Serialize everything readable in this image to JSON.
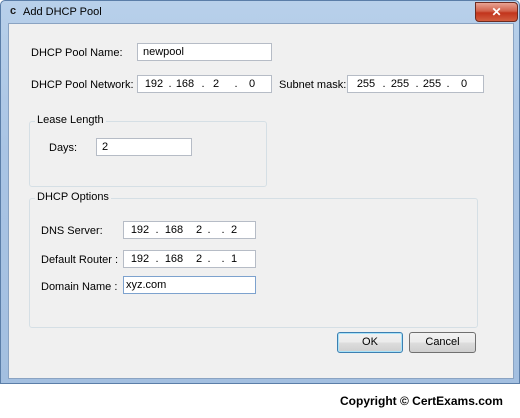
{
  "window": {
    "title": "Add DHCP Pool",
    "app_icon_glyph": "c",
    "close_glyph": "✕"
  },
  "pool": {
    "name_label": "DHCP Pool Name:",
    "name_value": "newpool",
    "network_label": "DHCP Pool Network:",
    "network_octets": [
      "192",
      "168",
      "2",
      "0"
    ],
    "subnet_label": "Subnet mask:",
    "subnet_octets": [
      "255",
      "255",
      "255",
      "0"
    ]
  },
  "lease": {
    "legend": "Lease Length",
    "days_label": "Days:",
    "days_value": "2"
  },
  "options": {
    "legend": "DHCP Options",
    "dns_label": "DNS Server:",
    "dns_octets": [
      "192",
      "168",
      "2",
      "2"
    ],
    "router_label": "Default Router :",
    "router_octets": [
      "192",
      "168",
      "2",
      "1"
    ],
    "domain_label": "Domain Name :",
    "domain_value": "xyz.com"
  },
  "buttons": {
    "ok": "OK",
    "cancel": "Cancel"
  },
  "footer": {
    "copyright": "Copyright  ©  CertExams.com"
  },
  "colors": {
    "title_bar": "#a9c4e4",
    "close_button": "#c2341c",
    "client_bg": "#f0f0f0",
    "default_button_border": "#3c7fb1"
  }
}
